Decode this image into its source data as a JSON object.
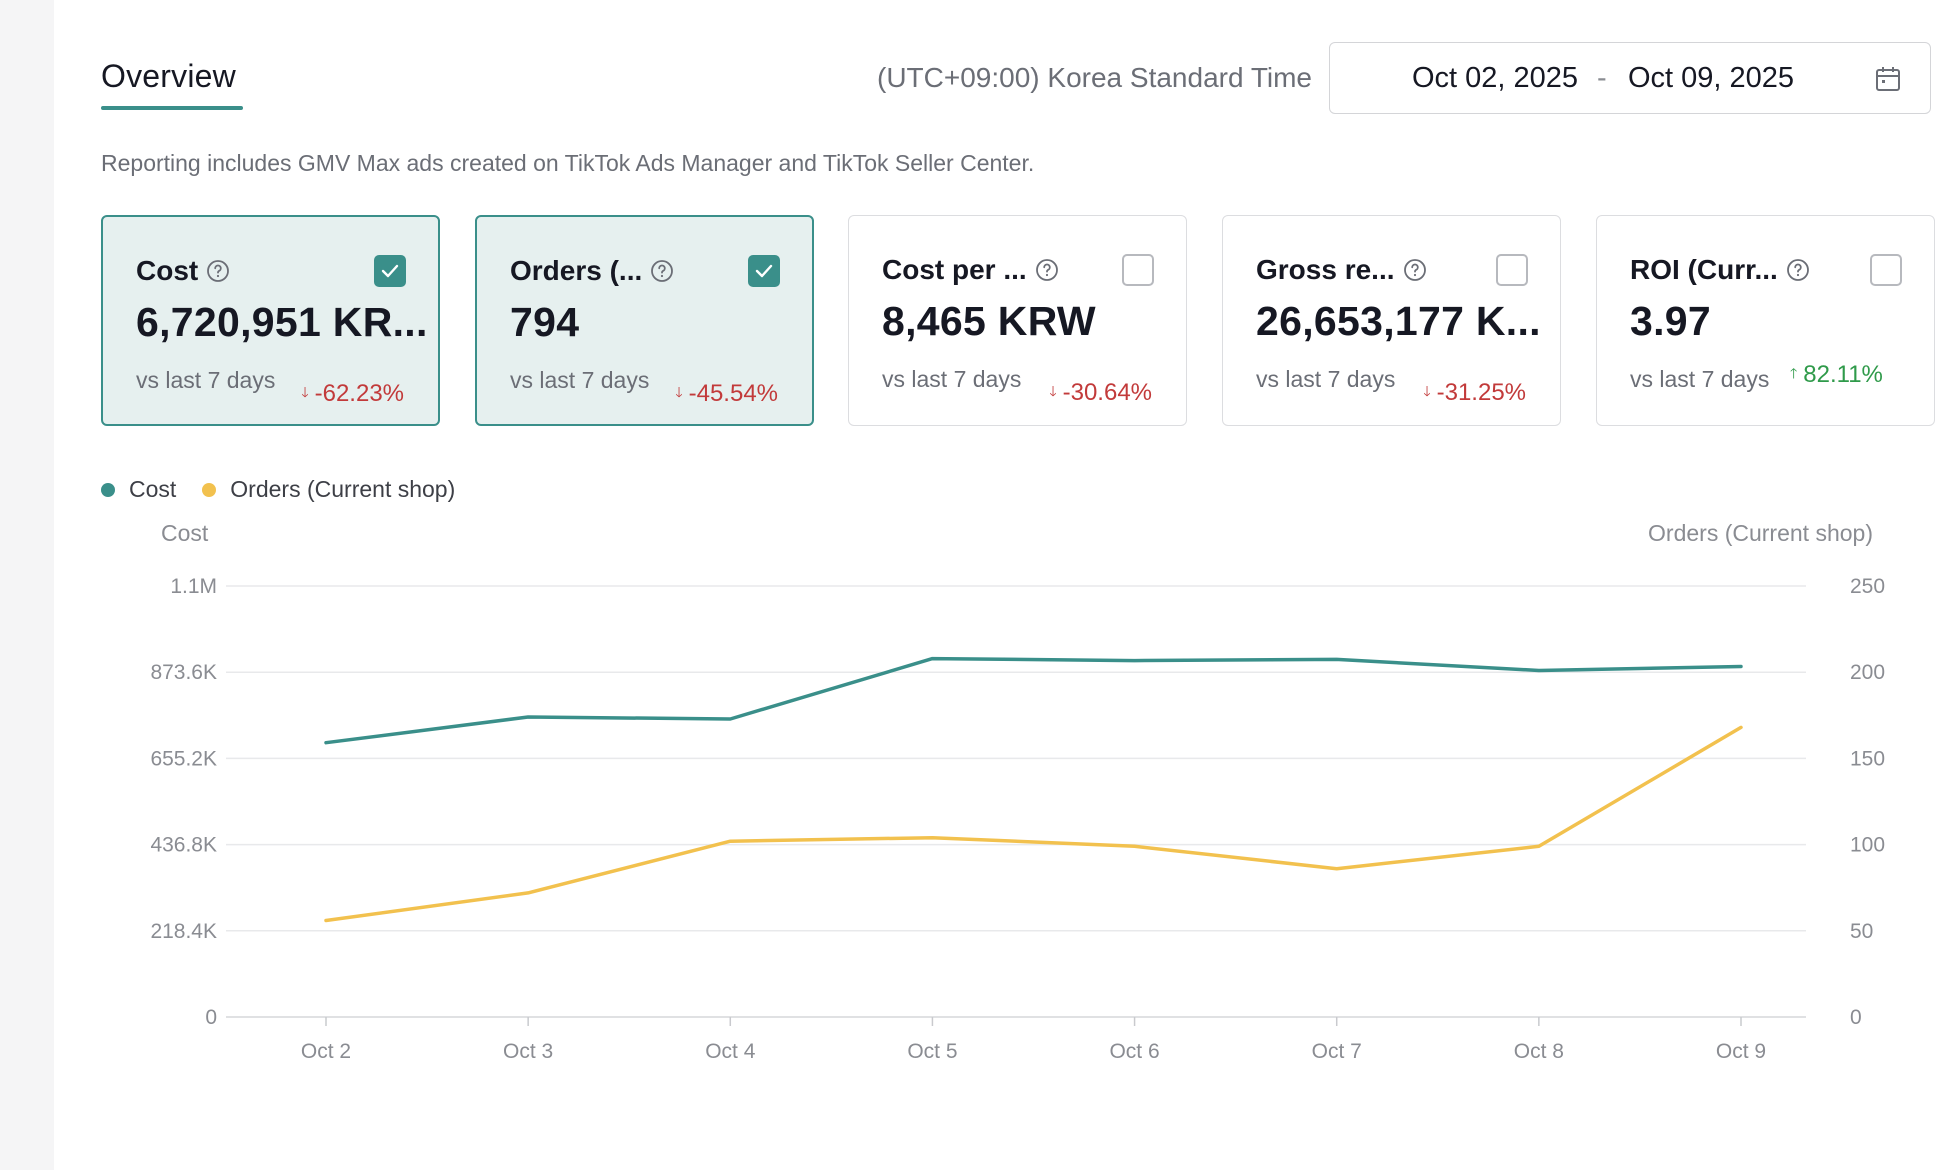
{
  "header": {
    "tab_label": "Overview",
    "timezone": "(UTC+09:00) Korea Standard Time",
    "date_start": "Oct 02, 2025",
    "date_separator": "-",
    "date_end": "Oct 09, 2025"
  },
  "note": "Reporting includes GMV Max ads created on TikTok Ads Manager and TikTok Seller Center.",
  "metrics": [
    {
      "title": "Cost",
      "value": "6,720,951 KR...",
      "compare": "vs last 7 days",
      "change": "-62.23%",
      "direction": "down",
      "checked": true
    },
    {
      "title": "Orders (...",
      "value": "794",
      "compare": "vs last 7 days",
      "change": "-45.54%",
      "direction": "down",
      "checked": true
    },
    {
      "title": "Cost per ...",
      "value": "8,465 KRW",
      "compare": "vs last 7 days",
      "change": "-30.64%",
      "direction": "down",
      "checked": false
    },
    {
      "title": "Gross re...",
      "value": "26,653,177 K...",
      "compare": "vs last 7 days",
      "change": "-31.25%",
      "direction": "down",
      "checked": false
    },
    {
      "title": "ROI (Curr...",
      "value": "3.97",
      "compare": "vs last 7 days",
      "change": "82.11%",
      "direction": "up",
      "checked": false
    }
  ],
  "colors": {
    "accent": "#3a8f8a",
    "cost_line": "#3a8f8a",
    "orders_line": "#f2c14e",
    "down": "#c23a3a",
    "up": "#2f9a4a"
  },
  "chart_data": {
    "type": "line",
    "categories": [
      "Oct 2",
      "Oct 3",
      "Oct 4",
      "Oct 5",
      "Oct 6",
      "Oct 7",
      "Oct 8",
      "Oct 9"
    ],
    "series": [
      {
        "name": "Cost",
        "axis": "left",
        "values": [
          695000,
          760000,
          755000,
          908000,
          903000,
          906000,
          878000,
          888000
        ]
      },
      {
        "name": "Orders (Current shop)",
        "axis": "right",
        "values": [
          56,
          72,
          102,
          104,
          99,
          86,
          99,
          168
        ]
      }
    ],
    "left_axis": {
      "title": "Cost",
      "ticks": [
        "0",
        "218.4K",
        "436.8K",
        "655.2K",
        "873.6K",
        "1.1M"
      ],
      "range": [
        0,
        1092000
      ]
    },
    "right_axis": {
      "title": "Orders (Current shop)",
      "ticks": [
        "0",
        "50",
        "100",
        "150",
        "200",
        "250"
      ],
      "range": [
        0,
        250
      ]
    },
    "grid": true,
    "legend": "top-left"
  }
}
